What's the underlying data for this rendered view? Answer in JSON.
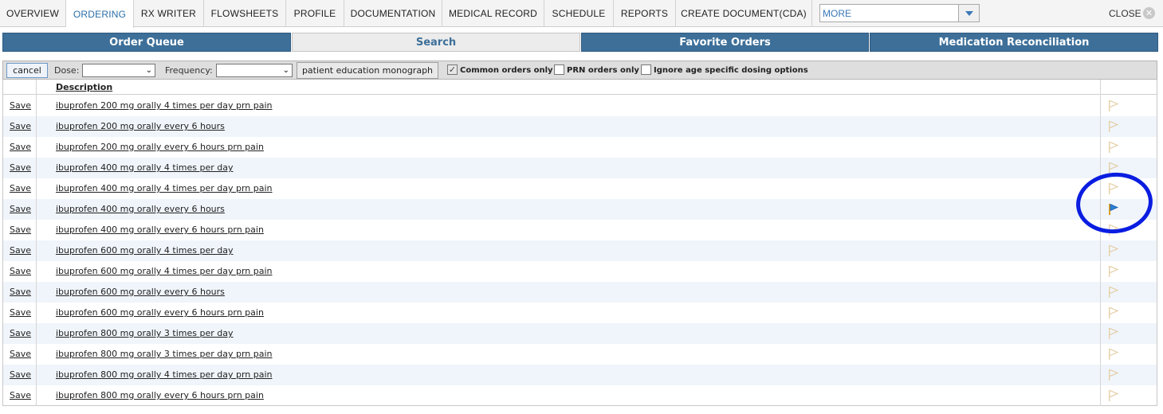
{
  "nav": {
    "tabs": [
      {
        "label": "OVERVIEW"
      },
      {
        "label": "ORDERING"
      },
      {
        "label": "RX WRITER"
      },
      {
        "label": "FLOWSHEETS"
      },
      {
        "label": "PROFILE"
      },
      {
        "label": "DOCUMENTATION"
      },
      {
        "label": "MEDICAL RECORD"
      },
      {
        "label": "SCHEDULE"
      },
      {
        "label": "REPORTS"
      },
      {
        "label": "CREATE DOCUMENT(CDA)"
      }
    ],
    "active_tab": "ORDERING",
    "more_label": "MORE",
    "close_label": "CLOSE"
  },
  "sections": {
    "tabs": [
      {
        "label": "Order Queue"
      },
      {
        "label": "Search"
      },
      {
        "label": "Favorite Orders"
      },
      {
        "label": "Medication Reconciliation"
      }
    ],
    "active_tab": "Search"
  },
  "toolbar": {
    "cancel_label": "cancel",
    "dose_label": "Dose:",
    "dose_value": "",
    "frequency_label": "Frequency:",
    "frequency_value": "",
    "education_button_label": "patient education monograph",
    "common_orders_label": "Common orders only",
    "common_orders_checked": true,
    "prn_orders_label": "PRN orders only",
    "prn_orders_checked": false,
    "ignore_age_label": "Ignore age specific dosing options",
    "ignore_age_checked": false
  },
  "table": {
    "header_description": "Description",
    "save_label": "Save",
    "rows": [
      {
        "description": "ibuprofen 200 mg orally 4 times per day prn pain",
        "flag": "empty"
      },
      {
        "description": "ibuprofen 200 mg orally every 6 hours",
        "flag": "empty"
      },
      {
        "description": "ibuprofen 200 mg orally every 6 hours prn pain",
        "flag": "empty"
      },
      {
        "description": "ibuprofen 400 mg orally 4 times per day",
        "flag": "empty"
      },
      {
        "description": "ibuprofen 400 mg orally 4 times per day prn pain",
        "flag": "empty"
      },
      {
        "description": "ibuprofen 400 mg orally every 6 hours",
        "flag": "favorite"
      },
      {
        "description": "ibuprofen 400 mg orally every 6 hours prn pain",
        "flag": "empty"
      },
      {
        "description": "ibuprofen 600 mg orally 4 times per day",
        "flag": "empty"
      },
      {
        "description": "ibuprofen 600 mg orally 4 times per day prn pain",
        "flag": "empty"
      },
      {
        "description": "ibuprofen 600 mg orally every 6 hours",
        "flag": "empty"
      },
      {
        "description": "ibuprofen 600 mg orally every 6 hours prn pain",
        "flag": "empty"
      },
      {
        "description": "ibuprofen 800 mg orally 3 times per day",
        "flag": "empty"
      },
      {
        "description": "ibuprofen 800 mg orally 3 times per day prn pain",
        "flag": "empty"
      },
      {
        "description": "ibuprofen 800 mg orally 4 times per day prn pain",
        "flag": "empty"
      },
      {
        "description": "ibuprofen 800 mg orally every 6 hours prn pain",
        "flag": "empty"
      }
    ]
  },
  "icons": {
    "flag_empty": "flag-outline-icon",
    "flag_favorite": "flag-filled-icon",
    "annotation": "hand-drawn-circle"
  },
  "colors": {
    "section_tab_bg": "#3d6f99",
    "active_nav_text": "#2a6fa8",
    "row_alt_bg": "#f0f5fb",
    "flag_favorite_blue": "#2c7fd6",
    "flag_favorite_pole": "#e0a020",
    "annotation_blue": "#0a1de0"
  }
}
